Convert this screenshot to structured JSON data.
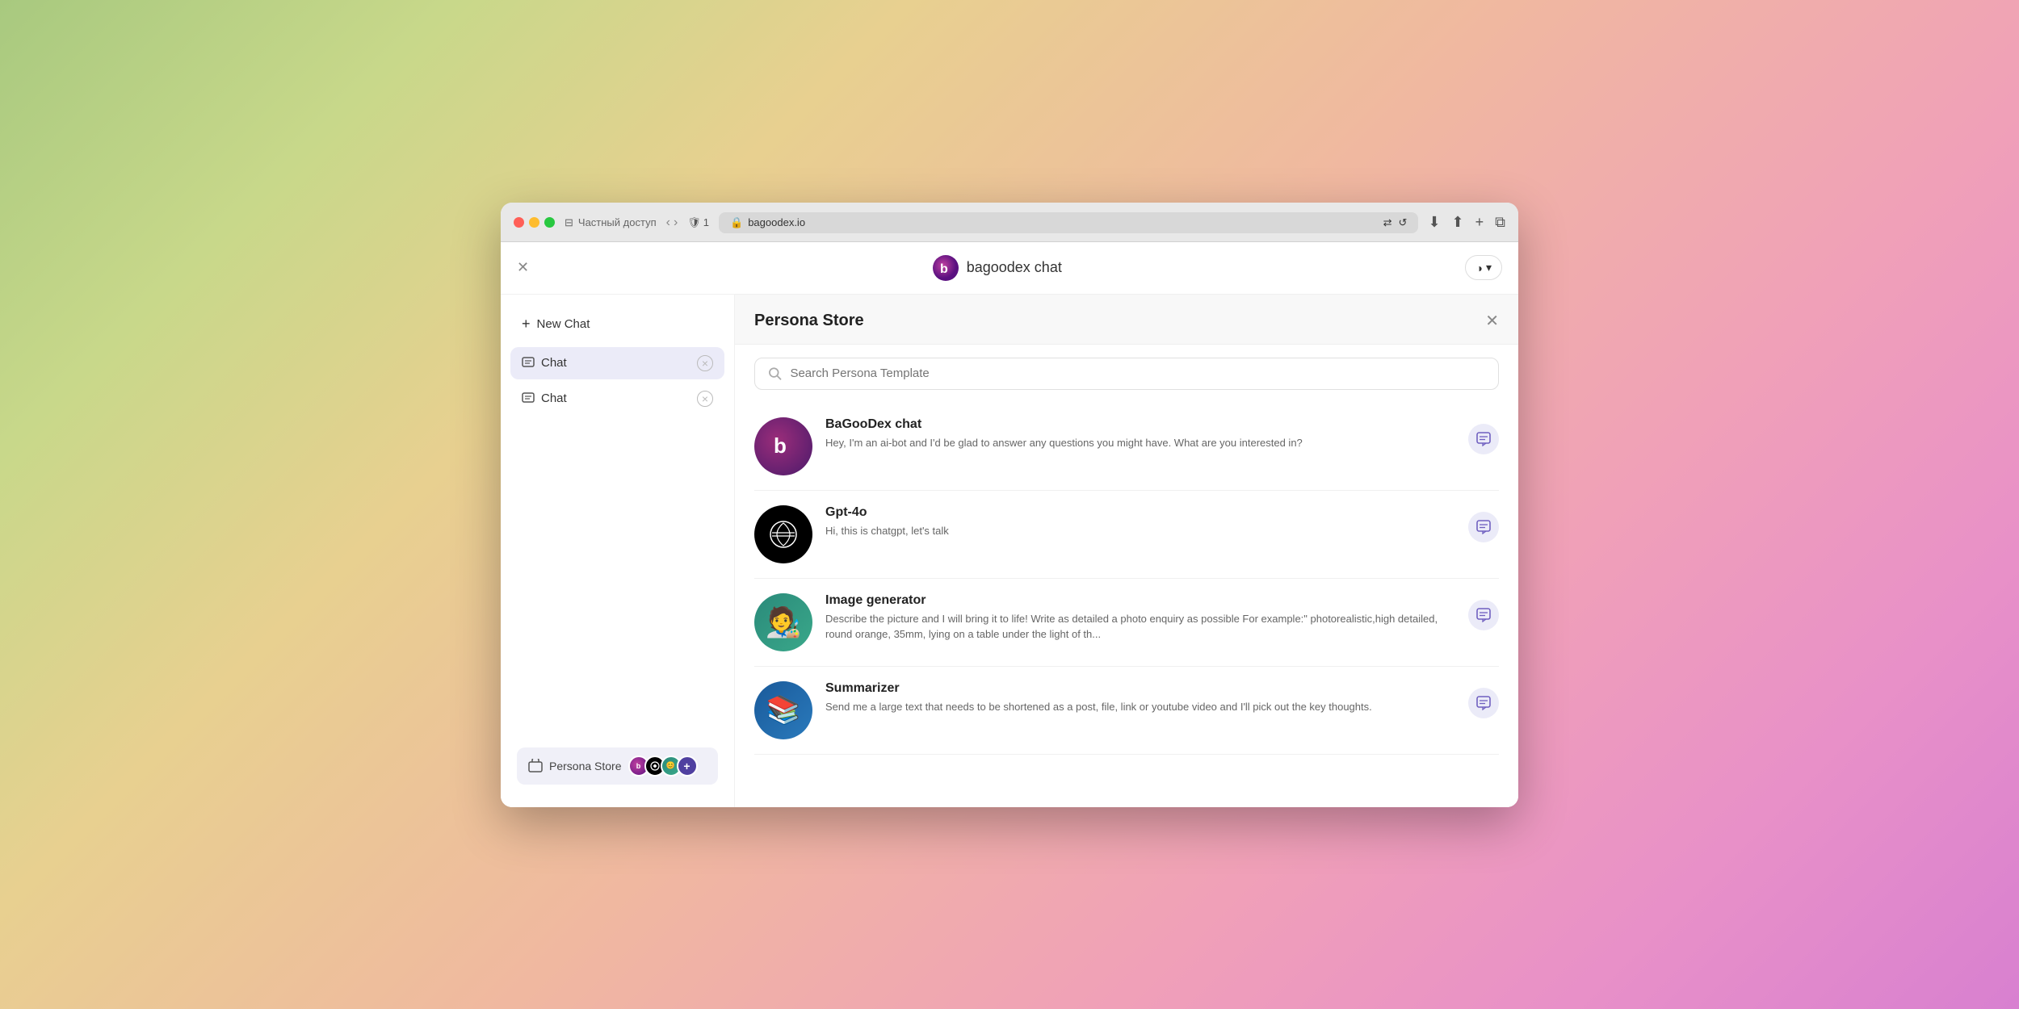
{
  "browser": {
    "url": "bagoodex.io",
    "private_label": "Частный доступ",
    "shield_count": "1"
  },
  "header": {
    "brand": "bagoodex chat",
    "close_label": "✕",
    "theme_icon": "◑",
    "theme_arrow": "▾"
  },
  "sidebar": {
    "new_chat_label": "New Chat",
    "chat_items": [
      {
        "label": "Chat",
        "active": true
      },
      {
        "label": "Chat",
        "active": false
      }
    ],
    "persona_store_label": "Persona Store"
  },
  "persona_store": {
    "title": "Persona Store",
    "search_placeholder": "Search Persona Template",
    "personas": [
      {
        "name": "BaGooDex chat",
        "description": "Hey, I'm an ai-bot and I'd be glad to answer any questions you might have. What are you interested in?"
      },
      {
        "name": "Gpt-4o",
        "description": "Hi, this is chatgpt, let's talk"
      },
      {
        "name": "Image generator",
        "description": "Describe the picture and I will bring it to life! Write as detailed a photo enquiry as possible For example:\" photorealistic,high detailed, round orange, 35mm, lying on a table under the light of th..."
      },
      {
        "name": "Summarizer",
        "description": "Send me a large text that needs to be shortened as a post, file, link or youtube video and I'll pick out the key thoughts."
      }
    ]
  },
  "colors": {
    "active_chat_bg": "#ebebf8",
    "persona_btn_bg": "#ebebf8",
    "accent": "#5040a0"
  }
}
